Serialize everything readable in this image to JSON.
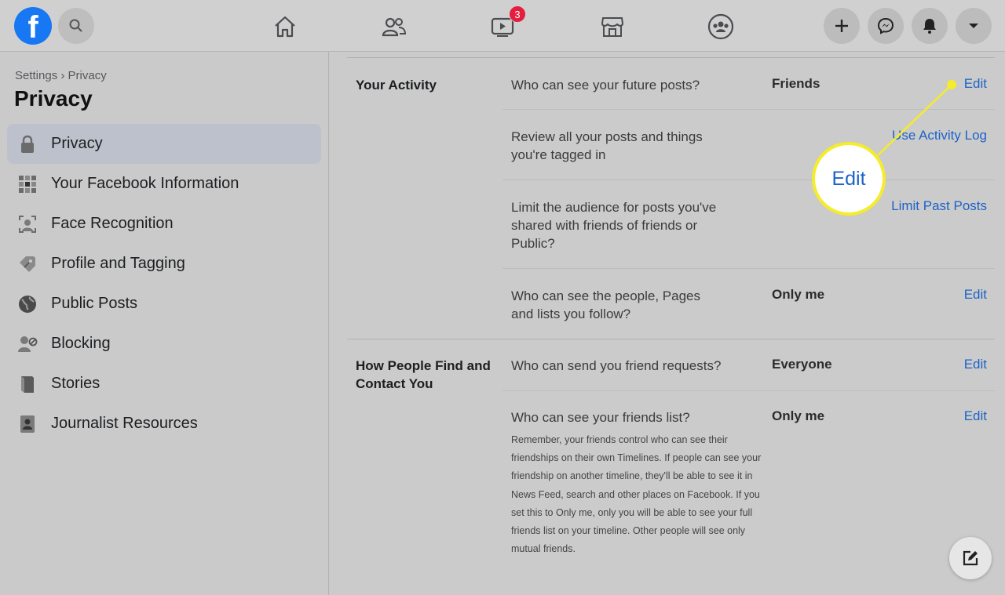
{
  "topbar": {
    "logo_letter": "f",
    "watch_badge": "3"
  },
  "sidebar": {
    "breadcrumb": "Settings › Privacy",
    "title": "Privacy",
    "items": [
      {
        "label": "Privacy",
        "icon": "lock-icon",
        "active": true
      },
      {
        "label": "Your Facebook Information",
        "icon": "grid-info-icon"
      },
      {
        "label": "Face Recognition",
        "icon": "face-scan-icon"
      },
      {
        "label": "Profile and Tagging",
        "icon": "tag-icon"
      },
      {
        "label": "Public Posts",
        "icon": "globe-icon"
      },
      {
        "label": "Blocking",
        "icon": "user-block-icon"
      },
      {
        "label": "Stories",
        "icon": "book-icon"
      },
      {
        "label": "Journalist Resources",
        "icon": "id-badge-icon"
      }
    ]
  },
  "main": {
    "sections": [
      {
        "title": "Your Activity",
        "rows": [
          {
            "question": "Who can see your future posts?",
            "value": "Friends",
            "action": "Edit"
          },
          {
            "question": "Review all your posts and things you're tagged in",
            "value": "",
            "action": "Use Activity Log"
          },
          {
            "question": "Limit the audience for posts you've shared with friends of friends or Public?",
            "value": "",
            "action": "Limit Past Posts"
          },
          {
            "question": "Who can see the people, Pages and lists you follow?",
            "value": "Only me",
            "action": "Edit"
          }
        ]
      },
      {
        "title": "How People Find and Contact You",
        "rows": [
          {
            "question": "Who can send you friend requests?",
            "value": "Everyone",
            "action": "Edit"
          },
          {
            "question": "Who can see your friends list?",
            "value": "Only me",
            "action": "Edit",
            "note": "Remember, your friends control who can see their friendships on their own Timelines. If people can see your friendship on another timeline, they'll be able to see it in News Feed, search and other places on Facebook. If you set this to Only me, only you will be able to see your full friends list on your timeline. Other people will see only mutual friends."
          }
        ]
      }
    ]
  },
  "callout": {
    "label": "Edit",
    "color": "#f5ec2a"
  }
}
